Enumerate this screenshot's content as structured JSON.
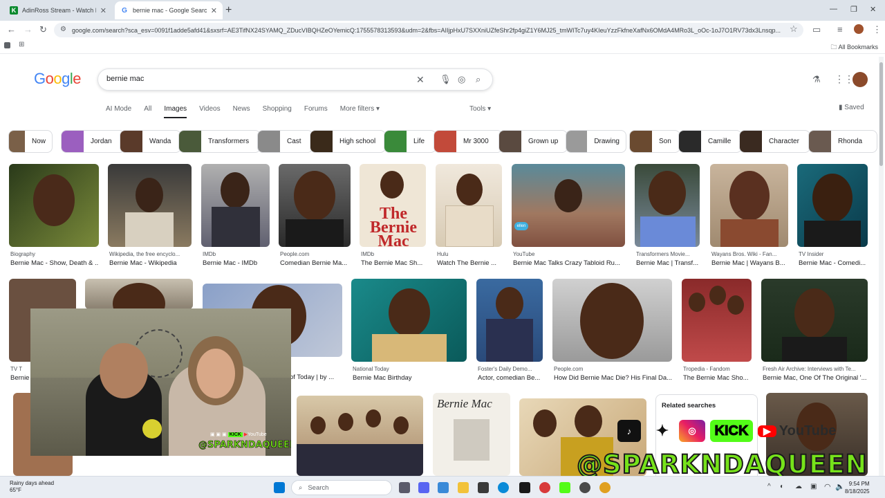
{
  "browser": {
    "tabs": [
      {
        "title": "AdinRoss Stream - Watch Live o",
        "favicon": "kick-icon",
        "color": "#53fc18"
      },
      {
        "title": "bernie mac - Google Search",
        "favicon": "google-icon",
        "color": "#4285f4"
      }
    ],
    "url": "google.com/search?sca_esv=0091f1adde5afd41&sxsrf=AE3TifNX24SYAMQ_ZDucVIBQHZeOYemicQ:1755578313593&udm=2&fbs=AIIjpHxU7SXXniUZfeShr2fp4giZ1Y6MJ25_tmWITc7uy4KIeuYzzFkfneXafNx6OMdA4MRo3L_oOc-1oJ7O1RV73dx3Lnsqp...",
    "bookmarks_label": "All Bookmarks"
  },
  "google": {
    "logo": "Google",
    "query": "bernie mac",
    "tabs": [
      "AI Mode",
      "All",
      "Images",
      "Videos",
      "News",
      "Shopping",
      "Forums",
      "More filters"
    ],
    "active_tab": "Images",
    "tools": "Tools",
    "saved": "Saved",
    "chips": [
      "Now",
      "Jordan",
      "Wanda",
      "Transformers",
      "Cast",
      "High school",
      "Life",
      "Mr 3000",
      "Grown up",
      "Drawing",
      "Son",
      "Camille",
      "Character",
      "Rhonda"
    ],
    "row1": [
      {
        "source": "Biography",
        "title": "Bernie Mac - Show, Death & ..."
      },
      {
        "source": "Wikipedia, the free encyclo...",
        "title": "Bernie Mac - Wikipedia"
      },
      {
        "source": "IMDb",
        "title": "Bernie Mac - IMDb"
      },
      {
        "source": "People.com",
        "title": "Comedian Bernie Ma..."
      },
      {
        "source": "IMDb",
        "title": "The Bernie Mac Sh..."
      },
      {
        "source": "Hulu",
        "title": "Watch The Bernie ..."
      },
      {
        "source": "YouTube",
        "title": "Bernie Mac Talks Crazy Tabloid Ru..."
      },
      {
        "source": "Transformers Movie...",
        "title": "Bernie Mac | Transf..."
      },
      {
        "source": "Wayans Bros. Wiki - Fan...",
        "title": "Bernie Mac | Wayans B..."
      },
      {
        "source": "TV Insider",
        "title": "Bernie Mac - Comedi..."
      }
    ],
    "row2": [
      {
        "source": "TV T",
        "title": "Bernie"
      },
      {
        "source": "",
        "title": "of Today | by ..."
      },
      {
        "source": "National Today",
        "title": "Bernie Mac Birthday"
      },
      {
        "source": "Foster's Daily Demo...",
        "title": "Actor, comedian Be..."
      },
      {
        "source": "People.com",
        "title": "How Did Bernie Mac Die? His Final Da..."
      },
      {
        "source": "Tropedia - Fandom",
        "title": "The Bernie Mac Sho..."
      },
      {
        "source": "Fresh Air Archive: Interviews with Te...",
        "title": "Bernie Mac, One Of The Original '..."
      }
    ],
    "poster_text": "The Bernie Mac",
    "album_text": "Bernie Mac",
    "related_title": "Related searches"
  },
  "overlay": {
    "handle": "@SPARKNDAQUEEN",
    "kick": "KICK",
    "youtube": "YouTube",
    "webcam_handle": "@SPARKNDAQUEEN",
    "webcam_youtube": "YouTube"
  },
  "taskbar": {
    "weather_title": "Rainy days ahead",
    "weather_temp": "65°F",
    "search": "Search",
    "time": "9:54 PM",
    "date": "8/18/2025"
  }
}
